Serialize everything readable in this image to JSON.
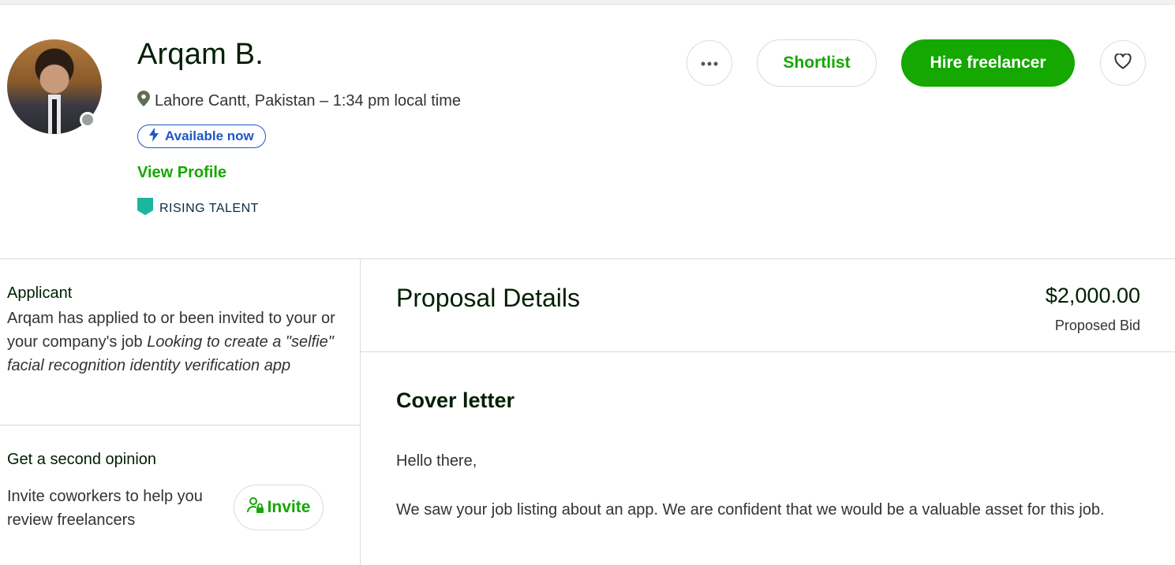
{
  "profile": {
    "name": "Arqam B.",
    "location": "Lahore Cantt, Pakistan – 1:34 pm local time",
    "availability": "Available now",
    "view_profile": "View Profile",
    "badge": "RISING TALENT"
  },
  "actions": {
    "shortlist": "Shortlist",
    "hire": "Hire freelancer"
  },
  "applicant": {
    "title": "Applicant",
    "text": "Arqam has applied to or been invited to your or your company's job ",
    "job_title": "Looking to create a \"selfie\" facial recognition identity verification app"
  },
  "second_opinion": {
    "title": "Get a second opinion",
    "text": "Invite coworkers to help you review freelancers",
    "invite": "Invite"
  },
  "proposal": {
    "title": "Proposal Details",
    "bid_amount": "$2,000.00",
    "bid_label": "Proposed Bid",
    "cover_title": "Cover letter",
    "cover_p1": "Hello there,",
    "cover_p2": "We saw your job listing about an app. We are confident that we would be a valuable asset for this job."
  },
  "colors": {
    "brand_green": "#14a800",
    "available_blue": "#1f57c3",
    "badge_teal": "#1cb5a0"
  },
  "icons": [
    "location-pin-icon",
    "lightning-icon",
    "rising-talent-badge-icon",
    "more-dots-icon",
    "heart-icon",
    "user-lock-icon"
  ]
}
